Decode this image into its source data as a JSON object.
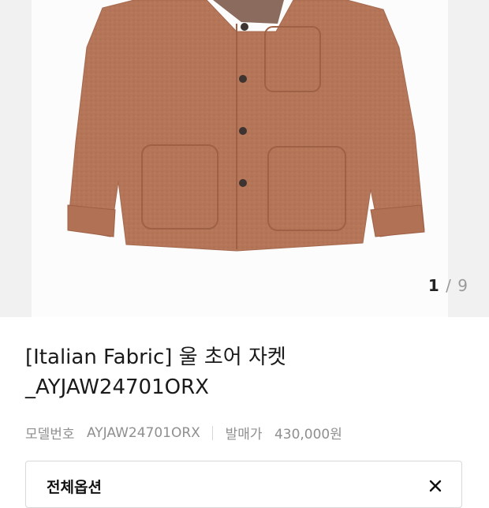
{
  "gallery": {
    "current": "1",
    "separator": "/",
    "total": "9"
  },
  "product": {
    "title": "[Italian Fabric] 울 초어 자켓 _AYJAW24701ORX",
    "model_label": "모델번호",
    "model_value": "AYJAW24701ORX",
    "price_label": "발매가",
    "price_value": "430,000원"
  },
  "options": {
    "label": "전체옵션"
  },
  "colors": {
    "jacket": "#b47558",
    "background": "#f1f1f1"
  }
}
